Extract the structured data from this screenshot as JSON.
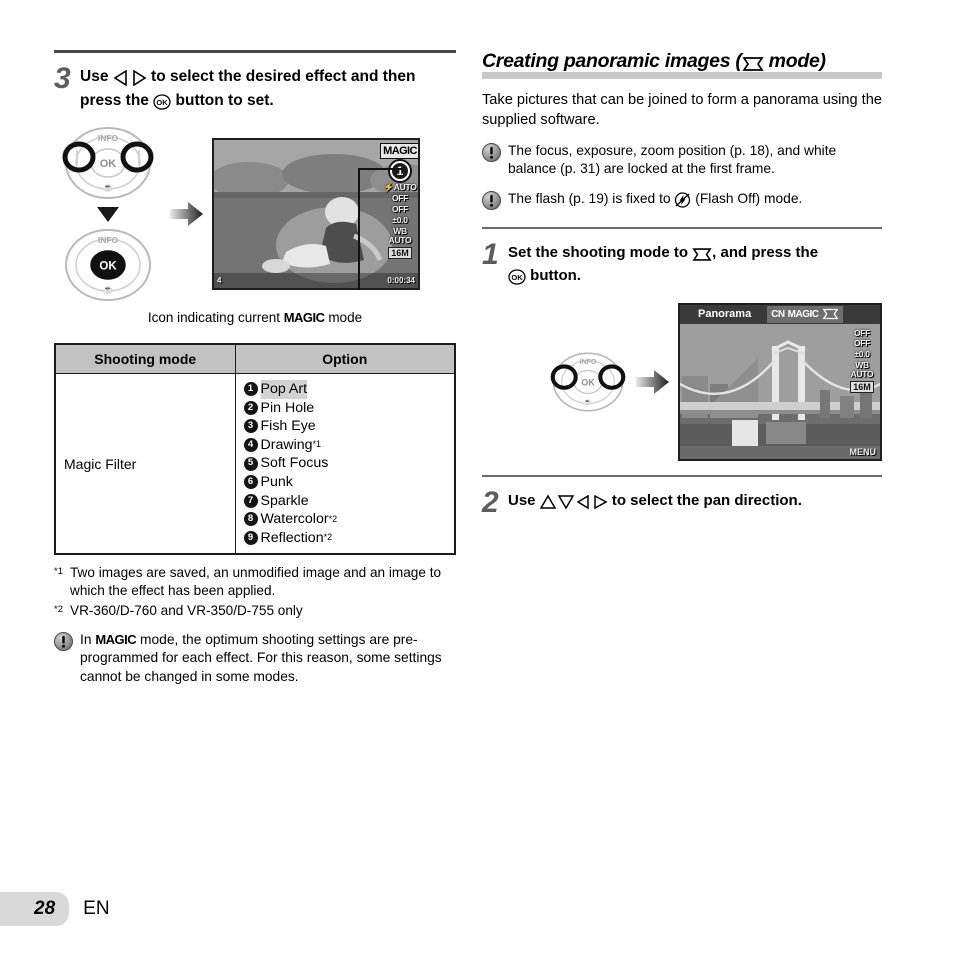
{
  "left_column": {
    "step": {
      "number": "3",
      "line1_pre": "Use ",
      "line1_mid": " to select the desired effect and then",
      "line2_pre": "press the ",
      "line2_post": " button to set."
    },
    "lcd": {
      "magic_tag": "MAGIC",
      "effect_number": "1",
      "osd": [
        "⚡AUTO",
        "OFF",
        "OFF",
        "±0.0",
        "WB AUTO",
        "16M"
      ],
      "bottom_left": "4",
      "bottom_right": "0:00:34"
    },
    "caption_pre": "Icon indicating current ",
    "caption_word": "MAGIC",
    "caption_post": " mode",
    "table": {
      "headers": [
        "Shooting mode",
        "Option"
      ],
      "mode": "Magic Filter",
      "options": [
        {
          "n": "1",
          "label": "Pop Art",
          "note": "",
          "highlight": true
        },
        {
          "n": "2",
          "label": "Pin Hole",
          "note": "",
          "highlight": false
        },
        {
          "n": "3",
          "label": "Fish Eye",
          "note": "",
          "highlight": false
        },
        {
          "n": "4",
          "label": "Drawing",
          "note": "*1",
          "highlight": false
        },
        {
          "n": "5",
          "label": "Soft Focus",
          "note": "",
          "highlight": false
        },
        {
          "n": "6",
          "label": "Punk",
          "note": "",
          "highlight": false
        },
        {
          "n": "7",
          "label": "Sparkle",
          "note": "",
          "highlight": false
        },
        {
          "n": "8",
          "label": "Watercolor",
          "note": "*2",
          "highlight": false
        },
        {
          "n": "9",
          "label": "Reflection",
          "note": "*2",
          "highlight": false
        }
      ]
    },
    "footnotes": [
      {
        "mark": "*1",
        "text": "Two images are saved, an unmodified image and an image to which the effect has been applied."
      },
      {
        "mark": "*2",
        "text": "VR-360/D-760 and VR-350/D-755 only"
      }
    ],
    "note": {
      "pre": "In ",
      "word": "MAGIC",
      "post": " mode, the optimum shooting settings are pre-programmed for each effect. For this reason, some settings cannot be changed in some modes."
    }
  },
  "right_column": {
    "section_title_pre": "Creating panoramic images (",
    "section_title_post": " mode)",
    "intro": "Take pictures that can be joined to form a panorama using the supplied software.",
    "notes": [
      "The focus, exposure, zoom position (p. 18), and white balance (p. 31) are locked at the first frame.",
      "The flash (p. 19) is fixed to  (Flash Off) mode."
    ],
    "note2_pre": "The flash (p. 19) is fixed to ",
    "note2_post": " (Flash Off) mode.",
    "step1": {
      "number": "1",
      "line1_pre": "Set the shooting mode to ",
      "line1_post": ", and press the",
      "line2_post": " button."
    },
    "pano": {
      "label": "Panorama",
      "modes": [
        "CN",
        "MAGIC"
      ],
      "osd": [
        "OFF",
        "OFF",
        "±0.0",
        "WB AUTO",
        "16M"
      ],
      "menu": "MENU"
    },
    "step2": {
      "number": "2",
      "pre": "Use ",
      "post": " to select the pan direction."
    }
  },
  "footer": {
    "page_number": "28",
    "language": "EN"
  }
}
